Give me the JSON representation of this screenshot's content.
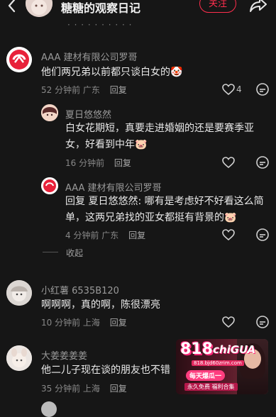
{
  "header": {
    "title": "糖糖的观察日记",
    "follow_label": "关注"
  },
  "partial_line": "· · · · ·  · · ·  · ·",
  "comments": [
    {
      "name": "AAA 建材有限公司罗哥",
      "text": "他们两兄弟以前都只谈白女的",
      "time": "52 分钟前",
      "location": "广东",
      "reply": "回复",
      "likes": "4"
    },
    {
      "name": "夏日悠悠然",
      "text1": "白女花期短，真要走进婚姻的还是要赛季亚",
      "text2": "女，好看到中年",
      "time": "16 分钟前",
      "reply": "回复"
    },
    {
      "name": "AAA 建材有限公司罗哥",
      "text1": "回复 夏日悠悠然: 哪有是考虑好不好看这么简",
      "text2": "单，这两兄弟找的亚女都挺有背景的",
      "time": "4 分钟前",
      "location": "广东",
      "reply": "回复"
    },
    {
      "name": "小红薯 6535B120",
      "text": "啊啊啊，真的啊，陈很漂亮",
      "time": "10 分钟前",
      "location": "上海",
      "reply": "回复"
    },
    {
      "name": "大姜姜姜姜",
      "text": "他二儿子现在谈的朋友也不错",
      "time": "35 分钟前",
      "location": "上海",
      "reply": "回复"
    }
  ],
  "collapse_label": "收起",
  "ad": {
    "big": "818",
    "brand": "chiGUA",
    "url": "818.bjd60zrim.com",
    "tag": "每天爆瓜一",
    "sub": "永久免费 福利合集"
  },
  "colors": {
    "accent": "#ff2e4d",
    "background": "#161616"
  }
}
